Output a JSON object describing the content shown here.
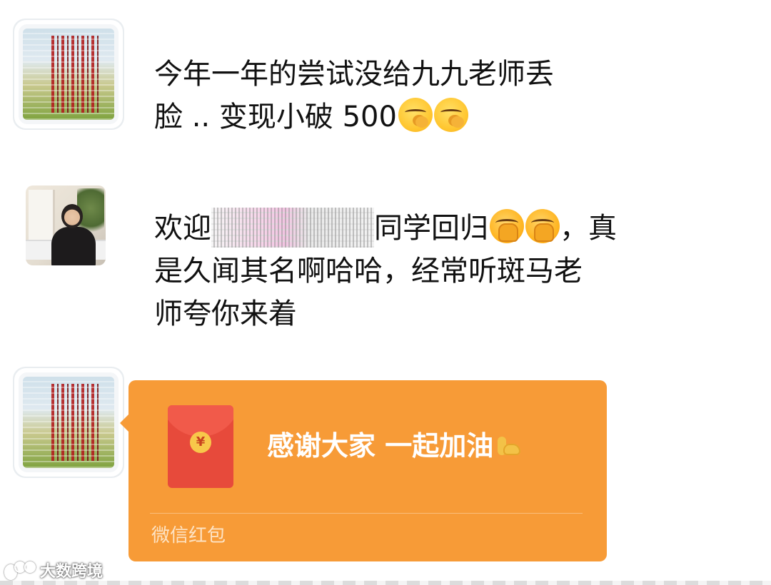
{
  "messages": [
    {
      "sender_avatar": "avatar-glitched-red-stripes",
      "text_line1": "今年一年的尝试没给九九老师丢",
      "text_line2_prefix": "脸 .. 变现小破 500",
      "emojis": [
        "smirk-emoji",
        "smirk-emoji"
      ]
    },
    {
      "sender_avatar": "avatar-woman-photo",
      "text_line1_prefix": "欢迎",
      "text_line1_mid": "同学回归",
      "text_line1_suffix": "，真",
      "text_line2": "是久闻其名啊哈哈，经常听斑马老",
      "text_line3": "师夸你来着",
      "emojis": [
        "shy-emoji",
        "shy-emoji"
      ]
    }
  ],
  "red_packet": {
    "sender_avatar": "avatar-glitched-red-stripes",
    "coin_symbol": "¥",
    "message": "感谢大家 一起加油",
    "emoji": "muscle-emoji",
    "footer": "微信红包",
    "color": "#f79b37"
  },
  "watermark": {
    "text": "大数跨境"
  }
}
